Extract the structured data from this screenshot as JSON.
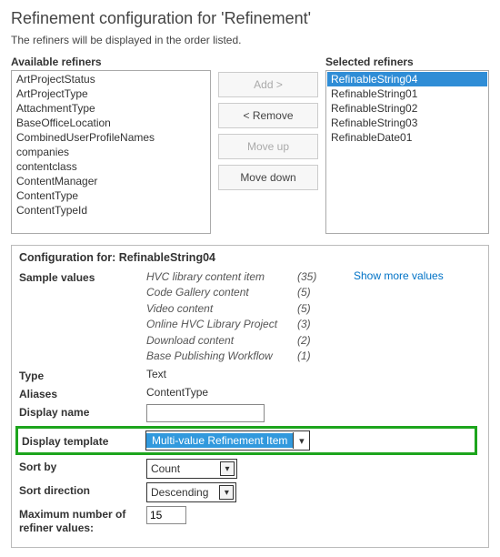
{
  "header": {
    "title": "Refinement configuration for 'Refinement'",
    "subtitle": "The refiners will be displayed in the order listed."
  },
  "available": {
    "label": "Available refiners",
    "items": [
      "ArtProjectStatus",
      "ArtProjectType",
      "AttachmentType",
      "BaseOfficeLocation",
      "CombinedUserProfileNames",
      "companies",
      "contentclass",
      "ContentManager",
      "ContentType",
      "ContentTypeId"
    ]
  },
  "selected": {
    "label": "Selected refiners",
    "items": [
      "RefinableString04",
      "RefinableString01",
      "RefinableString02",
      "RefinableString03",
      "RefinableDate01"
    ],
    "selected_index": 0
  },
  "buttons": {
    "add": "Add >",
    "remove": "< Remove",
    "moveup": "Move up",
    "movedown": "Move down"
  },
  "config": {
    "title_prefix": "Configuration for: ",
    "target": "RefinableString04",
    "labels": {
      "sample": "Sample values",
      "showmore": "Show more values",
      "type": "Type",
      "aliases": "Aliases",
      "displayname": "Display name",
      "displaytemplate": "Display template",
      "sortby": "Sort by",
      "sortdir": "Sort direction",
      "max": "Maximum number of refiner values:"
    },
    "sample_values": [
      {
        "name": "HVC library content item",
        "count": "(35)"
      },
      {
        "name": "Code Gallery content",
        "count": "(5)"
      },
      {
        "name": "Video content",
        "count": "(5)"
      },
      {
        "name": "Online HVC Library Project",
        "count": "(3)"
      },
      {
        "name": "Download content",
        "count": "(2)"
      },
      {
        "name": "Base Publishing Workflow",
        "count": "(1)"
      }
    ],
    "type_value": "Text",
    "aliases_value": "ContentType",
    "displayname_value": "",
    "displaytemplate_value": "Multi-value Refinement Item",
    "sortby_value": "Count",
    "sortdir_value": "Descending",
    "max_value": "15"
  }
}
